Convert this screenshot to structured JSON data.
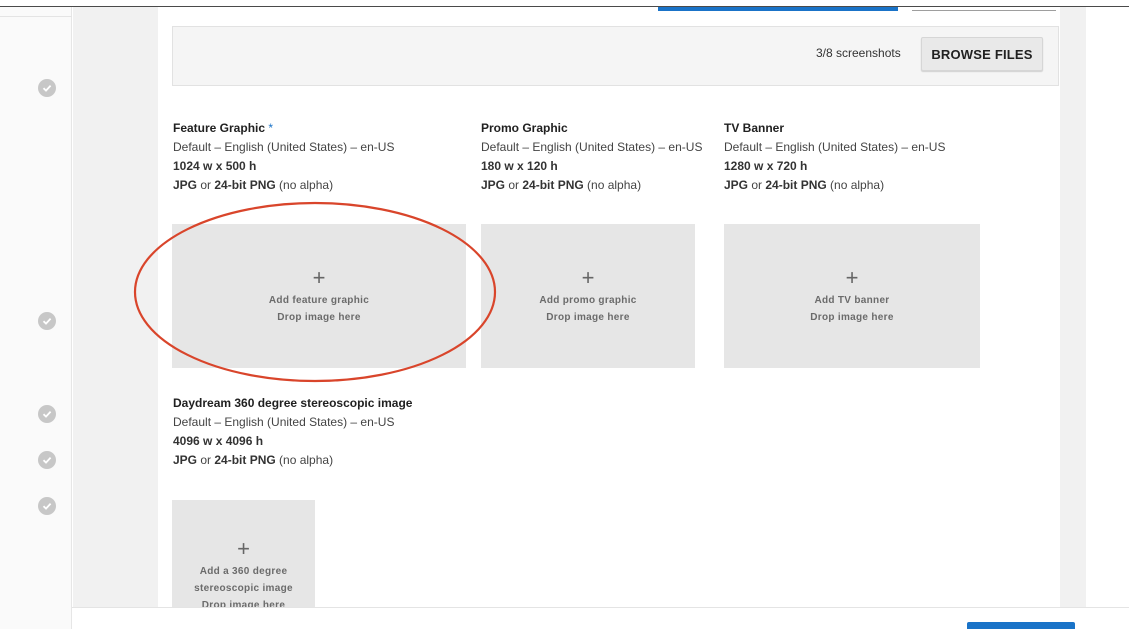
{
  "screenshots": {
    "count_label": "3/8 screenshots",
    "browse_label": "BROWSE FILES"
  },
  "graphics": [
    {
      "title": "Feature Graphic",
      "required_mark": "*",
      "locale": "Default – English (United States) – en-US",
      "size": "1024 w x 500 h",
      "format_a": "JPG",
      "format_or": " or ",
      "format_b": "24-bit PNG",
      "format_note": " (no alpha)",
      "drop_label": "Add feature graphic",
      "drop_hint": "Drop image here"
    },
    {
      "title": "Promo Graphic",
      "locale": "Default – English (United States) – en-US",
      "size": "180 w x 120 h",
      "format_a": "JPG",
      "format_or": " or ",
      "format_b": "24-bit PNG",
      "format_note": " (no alpha)",
      "drop_label": "Add promo graphic",
      "drop_hint": "Drop image here"
    },
    {
      "title": "TV Banner",
      "locale": "Default – English (United States) – en-US",
      "size": "1280 w x 720 h",
      "format_a": "JPG",
      "format_or": " or ",
      "format_b": "24-bit PNG",
      "format_note": " (no alpha)",
      "drop_label": "Add TV banner",
      "drop_hint": "Drop image here"
    },
    {
      "title": "Daydream 360 degree stereoscopic image",
      "locale": "Default – English (United States) – en-US",
      "size": "4096 w x 4096 h",
      "format_a": "JPG",
      "format_or": " or ",
      "format_b": "24-bit PNG",
      "format_note": " (no alpha)",
      "drop_label_1": "Add a 360 degree",
      "drop_label_2": "stereoscopic image",
      "drop_hint": "Drop image here"
    }
  ],
  "plus_glyph": "+",
  "colors": {
    "accent": "#1a73c8",
    "annotation": "#d9452b",
    "check": "#c7c7c7"
  },
  "icons": {
    "rail": "check-circle-icon",
    "add": "plus-icon"
  }
}
